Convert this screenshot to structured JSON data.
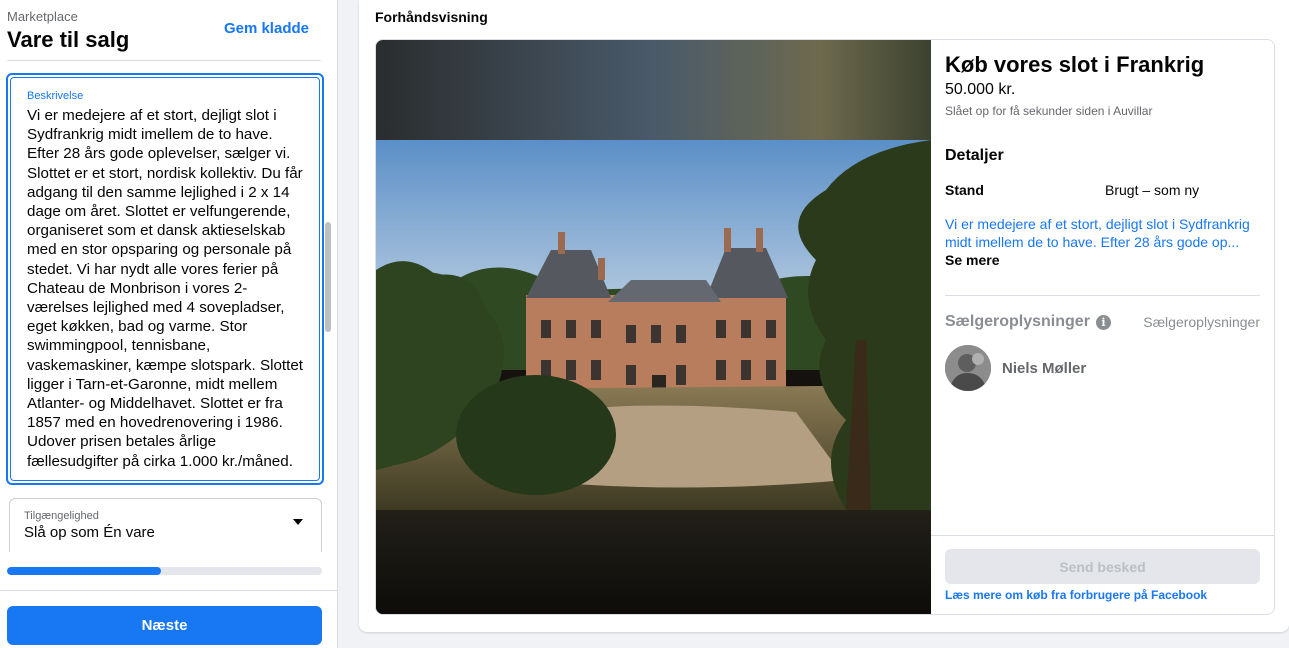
{
  "header": {
    "breadcrumb": "Marketplace",
    "title": "Vare til salg",
    "save_draft": "Gem kladde"
  },
  "form": {
    "description_label": "Beskrivelse",
    "description_value": "Vi er medejere af et stort, dejligt slot i Sydfrankrig midt imellem de to have. Efter 28 års gode oplevelser, sælger vi. Slottet er et stort, nordisk kollektiv. Du får adgang til den samme lejlighed i 2 x 14 dage om året. Slottet er velfungerende, organiseret som et dansk aktieselskab med en stor opsparing og personale på stedet. Vi har nydt alle vores ferier på Chateau de Monbrison i vores 2-værelses lejlighed med 4 sovepladser, eget køkken, bad og varme. Stor swimmingpool, tennisbane, vaskemaskiner, kæmpe slotspark. Slottet ligger i Tarn-et-Garonne, midt mellem Atlanter- og Middelhavet. Slottet er fra 1857 med en hovedrenovering i 1986. Udover prisen betales årlige fællesudgifter på cirka 1.000 kr./måned.",
    "availability_label": "Tilgængelighed",
    "availability_value": "Slå op som Én vare",
    "progress": 0.49,
    "next_label": "Næste"
  },
  "preview": {
    "section_title": "Forhåndsvisning",
    "listing_title": "Køb vores slot i Frankrig",
    "price": "50.000 kr.",
    "posted": "Slået op for få sekunder siden i Auvillar",
    "details_heading": "Detaljer",
    "condition_label": "Stand",
    "condition_value": "Brugt – som ny",
    "description_excerpt": "Vi er medejere af et stort, dejligt slot i Sydfrankrig midt imellem de to have. Efter 28 års gode op...",
    "see_more": "Se mere",
    "seller_heading": "Sælgeroplysninger",
    "seller_link": "Sælgeroplysninger",
    "seller_name": "Niels Møller",
    "send_label": "Send besked",
    "learn_more": "Læs mere om køb fra forbrugere på Facebook"
  },
  "colors": {
    "accent": "#1877f2",
    "background": "#f0f2f5",
    "disabled_button": "#e4e6eb"
  },
  "icons": {
    "dropdown": "caret-down-icon",
    "info": "info-icon"
  }
}
